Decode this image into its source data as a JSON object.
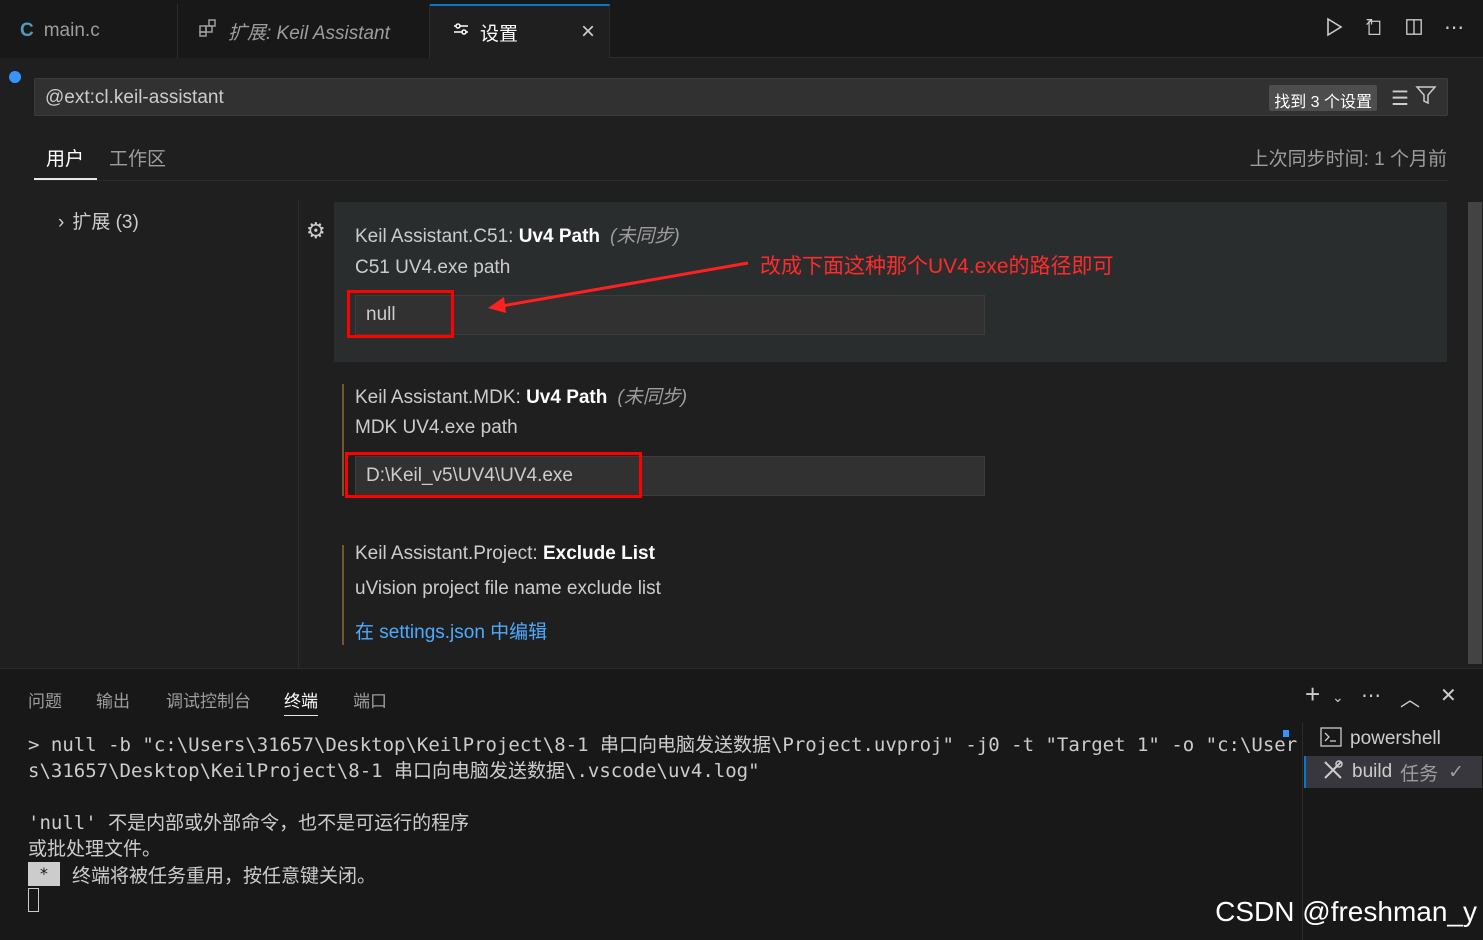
{
  "tabs": [
    {
      "label": "main.c",
      "icon": "C"
    },
    {
      "label": "扩展: Keil Assistant",
      "icon": "extensions-icon"
    },
    {
      "label": "设置",
      "icon": "settings-icon"
    }
  ],
  "tab_close": "×",
  "search": {
    "value": "@ext:cl.keil-assistant",
    "count": "找到 3 个设置"
  },
  "scope": {
    "user": "用户",
    "workspace": "工作区",
    "sync": "上次同步时间: 1 个月前"
  },
  "toc": {
    "label": "扩展 (3)"
  },
  "settings": [
    {
      "prefix": "Keil Assistant.C51: ",
      "name": "Uv4 Path",
      "sync": "(未同步)",
      "desc": "C51 UV4.exe path",
      "value": "null"
    },
    {
      "prefix": "Keil Assistant.MDK: ",
      "name": "Uv4 Path",
      "sync": "(未同步)",
      "desc": "MDK UV4.exe path",
      "value": "D:\\Keil_v5\\UV4\\UV4.exe"
    },
    {
      "prefix": "Keil Assistant.Project: ",
      "name": "Exclude List",
      "desc": "uVision project file name exclude list",
      "link": "在 settings.json 中编辑"
    }
  ],
  "annotation": "改成下面这种那个UV4.exe的路径即可",
  "panel": {
    "tabs": [
      "问题",
      "输出",
      "调试控制台",
      "终端",
      "端口"
    ],
    "active": "终端"
  },
  "terminal": {
    "line1": "> null -b \"c:\\Users\\31657\\Desktop\\KeilProject\\8-1 串口向电脑发送数据\\Project.uvproj\" -j0 -t \"Target 1\" -o \"c:\\User",
    "line2": "s\\31657\\Desktop\\KeilProject\\8-1 串口向电脑发送数据\\.vscode\\uv4.log\"",
    "line3": "",
    "line4": "'null' 不是内部或外部命令，也不是可运行的程序",
    "line5": "或批处理文件。",
    "star": "*",
    "reuse": "终端将被任务重用，按任意键关闭。"
  },
  "terminals": [
    {
      "label": "powershell"
    },
    {
      "label": "build",
      "sub": "任务"
    }
  ],
  "watermark": "CSDN @freshman_y"
}
